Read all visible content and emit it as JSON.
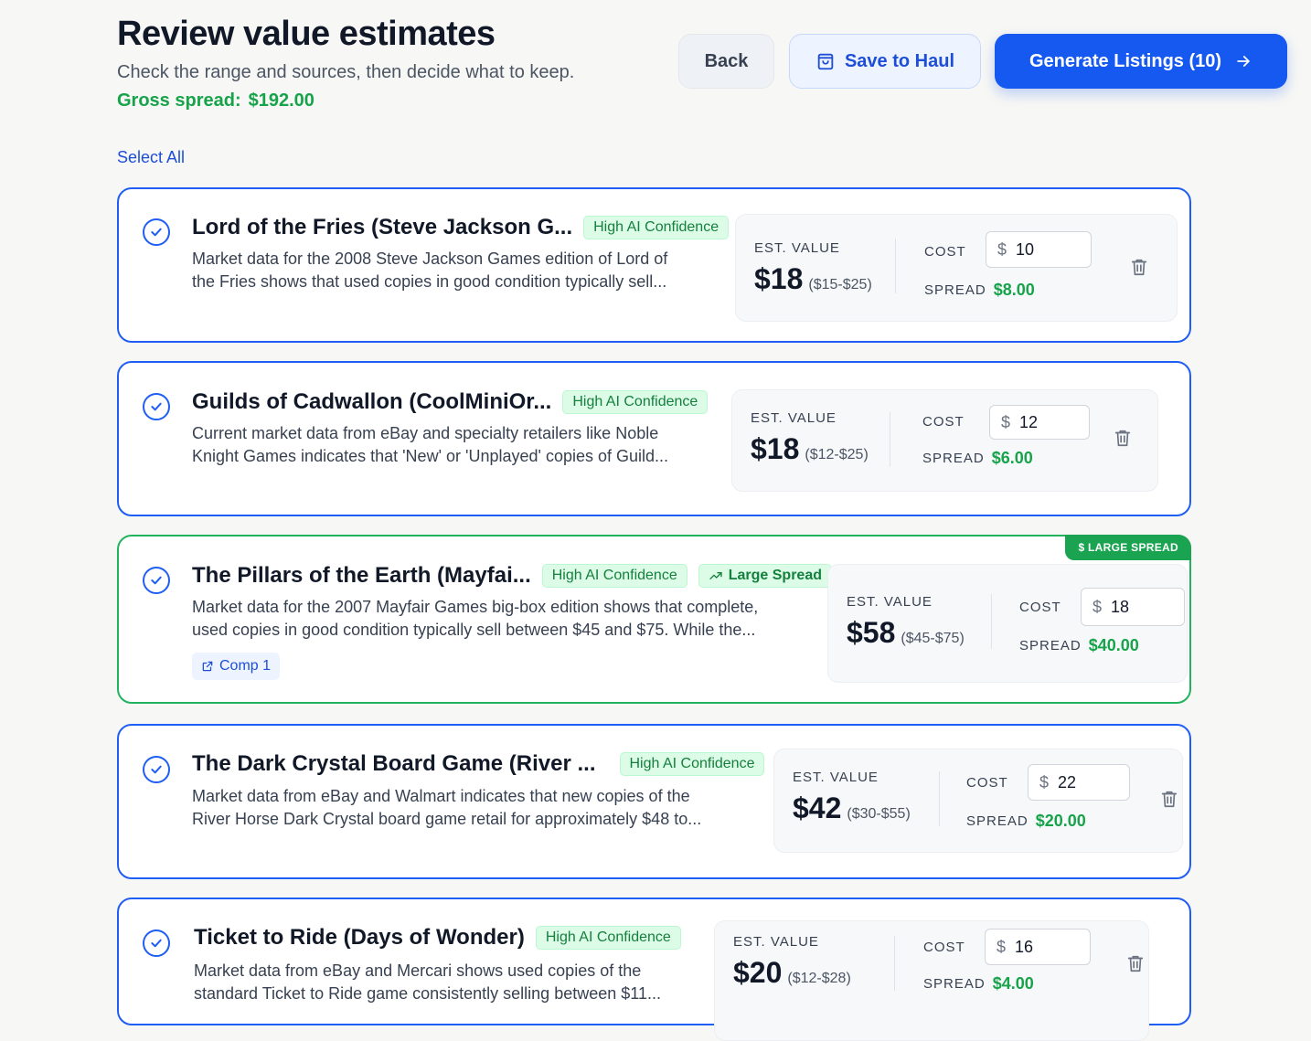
{
  "header": {
    "title": "Review value estimates",
    "subtitle": "Check the range and sources, then decide what to keep.",
    "gross_label": "Gross spread:",
    "gross_value": "$192.00"
  },
  "toolbar": {
    "back_label": "Back",
    "save_label": "Save to Haul",
    "generate_label": "Generate Listings (10)"
  },
  "select_all_label": "Select All",
  "labels": {
    "est_value": "EST. VALUE",
    "cost": "COST",
    "spread": "SPREAD",
    "currency": "$",
    "large_spread_ribbon": "$ LARGE SPREAD"
  },
  "items": [
    {
      "title": "Lord of the Fries (Steve Jackson G...",
      "confidence": "High AI Confidence",
      "desc_line1": "Market data for the 2008 Steve Jackson Games edition of Lord of",
      "desc_line2": "the Fries shows that used copies in good condition typically sell...",
      "est_value": "$18",
      "range": "($15-$25)",
      "cost": "10",
      "spread": "$8.00",
      "selected": true
    },
    {
      "title": "Guilds of Cadwallon (CoolMiniOr...",
      "confidence": "High AI Confidence",
      "desc_line1": "Current market data from eBay and specialty retailers like Noble",
      "desc_line2": "Knight Games indicates that 'New' or 'Unplayed' copies of Guild...",
      "est_value": "$18",
      "range": "($12-$25)",
      "cost": "12",
      "spread": "$6.00",
      "selected": true
    },
    {
      "title": "The Pillars of the Earth (Mayfai...",
      "confidence": "High AI Confidence",
      "spread_badge": "Large Spread",
      "desc_line1": "Market data for the 2007 Mayfair Games big-box edition shows that complete,",
      "desc_line2": "used copies in good condition typically sell between $45 and $75. While the...",
      "comp_label": "Comp 1",
      "est_value": "$58",
      "range": "($45-$75)",
      "cost": "18",
      "spread": "$40.00",
      "selected": true
    },
    {
      "title": "The Dark Crystal Board Game (River ...",
      "confidence": "High AI Confidence",
      "desc_line1": "Market data from eBay and Walmart indicates that new copies of the",
      "desc_line2": "River Horse Dark Crystal board game retail for approximately $48 to...",
      "est_value": "$42",
      "range": "($30-$55)",
      "cost": "22",
      "spread": "$20.00",
      "selected": true
    },
    {
      "title": "Ticket to Ride (Days of Wonder)",
      "confidence": "High AI Confidence",
      "desc_line1": "Market data from eBay and Mercari shows used copies of the",
      "desc_line2": "standard Ticket to Ride game consistently selling between $11...",
      "est_value": "$20",
      "range": "($12-$28)",
      "cost": "16",
      "spread": "$4.00",
      "selected": true
    }
  ],
  "colors": {
    "accent": "#1559f0",
    "card_border": "#1f5ef5",
    "highlight_border": "#22b35e",
    "positive": "#16a34a"
  }
}
